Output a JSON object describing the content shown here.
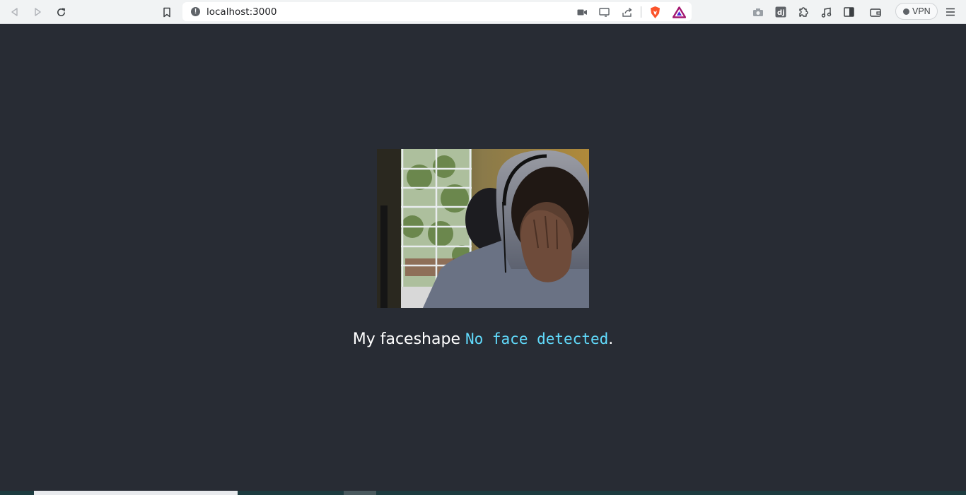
{
  "browser": {
    "url": "localhost:3000",
    "vpn_label": "VPN",
    "icons": {
      "back": "back-arrow-icon",
      "forward": "forward-arrow-icon",
      "reload": "reload-icon",
      "bookmark": "bookmark-icon",
      "info": "site-info-icon",
      "camera": "video-camera-icon",
      "cast": "cast-icon",
      "share": "share-icon",
      "brave": "brave-shields-icon",
      "rewards": "brave-rewards-icon",
      "screenshot": "screenshot-icon",
      "extension_dj": "dj-extension-icon",
      "extensions": "puzzle-icon",
      "media": "music-note-icon",
      "sidebar": "sidebar-icon",
      "wallet": "wallet-icon",
      "menu": "hamburger-menu-icon"
    }
  },
  "page": {
    "caption_prefix": "My faceshape ",
    "caption_value": "No face detected",
    "caption_suffix": ".",
    "accent_color": "#61dafb",
    "background_color": "#282c34"
  }
}
